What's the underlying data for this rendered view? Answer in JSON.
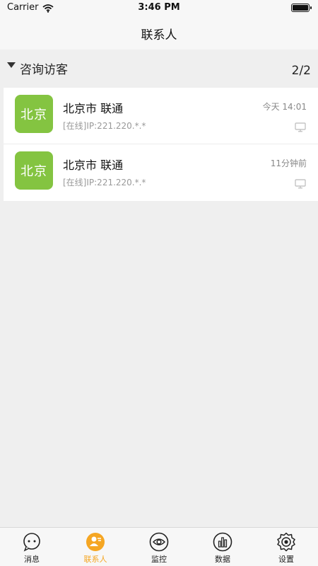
{
  "status": {
    "carrier": "Carrier",
    "time": "3:46 PM",
    "battery_level": 1.0
  },
  "nav": {
    "title": "联系人"
  },
  "group": {
    "title": "咨询访客",
    "count": "2/2"
  },
  "contacts": [
    {
      "avatar_text": "北京",
      "name": "北京市 联通",
      "time": "今天 14:01",
      "status": "[在线]IP:221.220.*.*"
    },
    {
      "avatar_text": "北京",
      "name": "北京市 联通",
      "time": "11分钟前",
      "status": "[在线]IP:221.220.*.*"
    }
  ],
  "tabs": [
    {
      "label": "消息",
      "icon": "message-icon"
    },
    {
      "label": "联系人",
      "icon": "contacts-icon",
      "active": true
    },
    {
      "label": "监控",
      "icon": "eye-icon"
    },
    {
      "label": "数据",
      "icon": "chart-icon"
    },
    {
      "label": "设置",
      "icon": "gear-icon"
    }
  ],
  "colors": {
    "accent": "#f5a623",
    "avatar": "#84c441",
    "background": "#efefef"
  }
}
